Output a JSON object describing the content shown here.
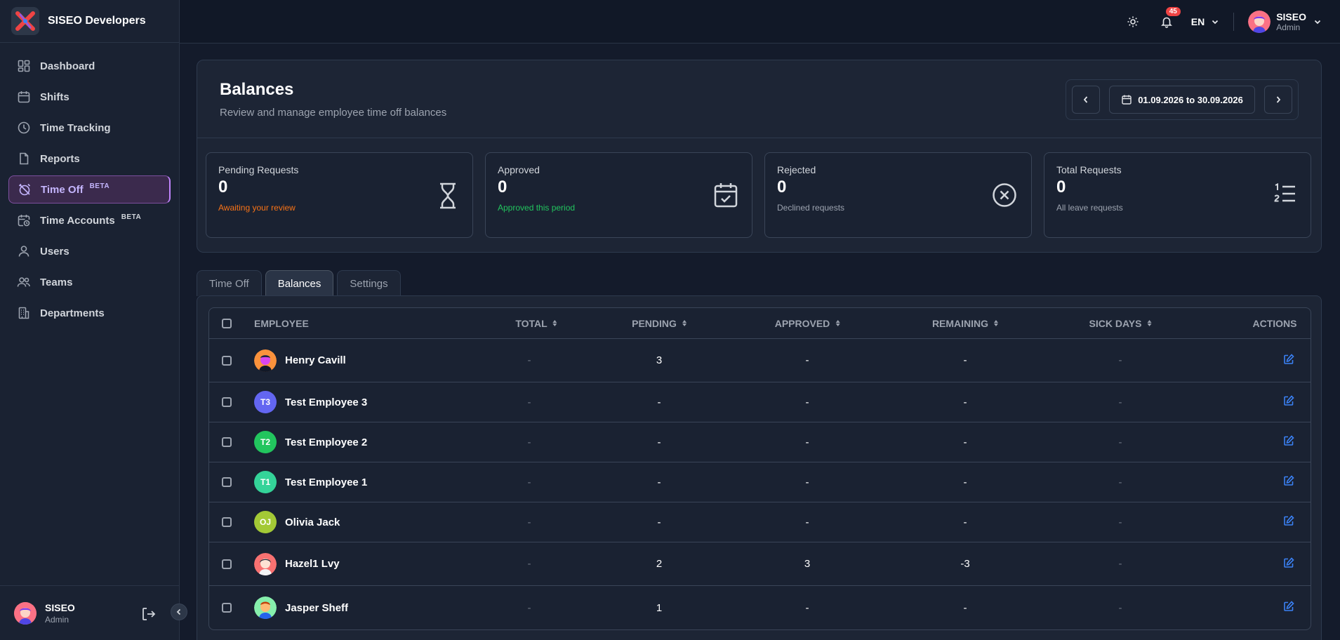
{
  "app": {
    "name": "SISEO Developers"
  },
  "sidebar": {
    "items": [
      {
        "label": "Dashboard",
        "icon": "dashboard-icon"
      },
      {
        "label": "Shifts",
        "icon": "calendar-icon"
      },
      {
        "label": "Time Tracking",
        "icon": "clock-icon"
      },
      {
        "label": "Reports",
        "icon": "report-icon"
      },
      {
        "label": "Time Off",
        "badge": "BETA",
        "icon": "alarm-off-icon",
        "active": true
      },
      {
        "label": "Time Accounts",
        "badge": "BETA",
        "icon": "calendar-clock-icon"
      },
      {
        "label": "Users",
        "icon": "user-icon"
      },
      {
        "label": "Teams",
        "icon": "users-icon"
      },
      {
        "label": "Departments",
        "icon": "building-icon"
      }
    ],
    "user": {
      "name": "SISEO",
      "role": "Admin"
    }
  },
  "topbar": {
    "notification_count": "45",
    "language": "EN",
    "user": {
      "name": "SISEO",
      "role": "Admin"
    }
  },
  "page": {
    "title": "Balances",
    "subtitle": "Review and manage employee time off balances",
    "date_range": "01.09.2026 to 30.09.2026"
  },
  "stats": [
    {
      "label": "Pending Requests",
      "value": "0",
      "note": "Awaiting your review",
      "note_color": "#f97316",
      "icon": "hourglass-icon"
    },
    {
      "label": "Approved",
      "value": "0",
      "note": "Approved this period",
      "note_color": "#22c55e",
      "icon": "calendar-check-icon"
    },
    {
      "label": "Rejected",
      "value": "0",
      "note": "Declined requests",
      "note_color": "#9ca3af",
      "icon": "circle-x-icon"
    },
    {
      "label": "Total Requests",
      "value": "0",
      "note": "All leave requests",
      "note_color": "#9ca3af",
      "icon": "numbered-list-icon"
    }
  ],
  "tabs": [
    {
      "label": "Time Off",
      "active": false
    },
    {
      "label": "Balances",
      "active": true
    },
    {
      "label": "Settings",
      "active": false
    }
  ],
  "table": {
    "headers": {
      "employee": "EMPLOYEE",
      "total": "TOTAL",
      "pending": "PENDING",
      "approved": "APPROVED",
      "remaining": "REMAINING",
      "sick": "SICK DAYS",
      "actions": "ACTIONS"
    },
    "rows": [
      {
        "name": "Henry Cavill",
        "avatar": "photo",
        "total": "-",
        "pending": "3",
        "approved": "-",
        "remaining": "-",
        "sick": "-"
      },
      {
        "name": "Test Employee 3",
        "initials": "T3",
        "avatar_color": "#6366f1",
        "total": "-",
        "pending": "-",
        "approved": "-",
        "remaining": "-",
        "sick": "-"
      },
      {
        "name": "Test Employee 2",
        "initials": "T2",
        "avatar_color": "#22c55e",
        "total": "-",
        "pending": "-",
        "approved": "-",
        "remaining": "-",
        "sick": "-"
      },
      {
        "name": "Test Employee 1",
        "initials": "T1",
        "avatar_color": "#34d399",
        "total": "-",
        "pending": "-",
        "approved": "-",
        "remaining": "-",
        "sick": "-"
      },
      {
        "name": "Olivia Jack",
        "initials": "OJ",
        "avatar_color": "#a3c936",
        "total": "-",
        "pending": "-",
        "approved": "-",
        "remaining": "-",
        "sick": "-"
      },
      {
        "name": "Hazel1 Lvy",
        "avatar": "photo",
        "total": "-",
        "pending": "2",
        "approved": "3",
        "remaining": "-3",
        "sick": "-"
      },
      {
        "name": "Jasper Sheff",
        "avatar": "photo",
        "total": "-",
        "pending": "1",
        "approved": "-",
        "remaining": "-",
        "sick": "-"
      }
    ]
  }
}
